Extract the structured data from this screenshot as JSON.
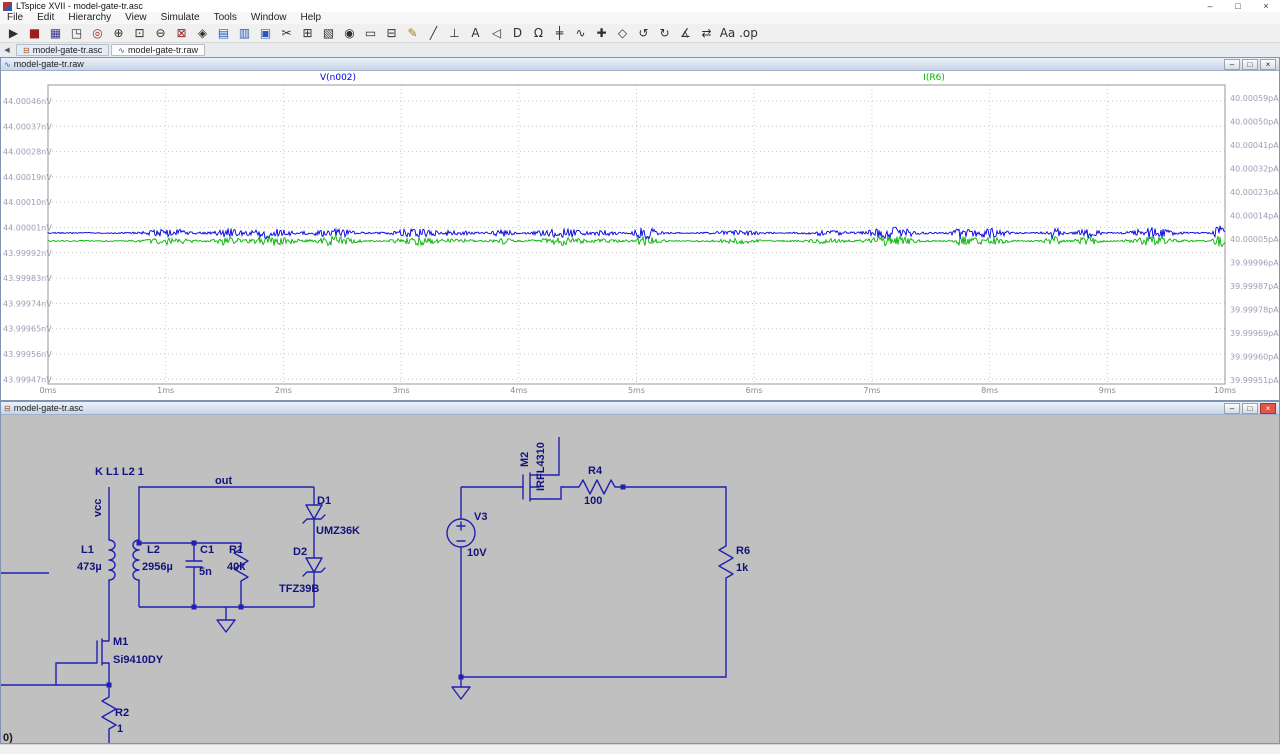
{
  "titlebar": {
    "title": "LTspice XVII - model-gate-tr.asc",
    "minimize": "–",
    "maximize": "□",
    "close": "×"
  },
  "chrome": {
    "minimize": "–",
    "maximize": "□",
    "close": "×"
  },
  "menu": {
    "items": [
      "File",
      "Edit",
      "Hierarchy",
      "View",
      "Simulate",
      "Tools",
      "Window",
      "Help"
    ]
  },
  "toolbar": {
    "icons": [
      {
        "name": "run-icon",
        "glyph": "▶",
        "color": "#303030"
      },
      {
        "name": "halt-icon",
        "glyph": "■",
        "color": "#9c1f1f"
      },
      {
        "name": "save-icon",
        "glyph": "▦",
        "color": "#39398f"
      },
      {
        "name": "autoscale-icon",
        "glyph": "◳",
        "color": "#303030"
      },
      {
        "name": "probe-icon",
        "glyph": "◎",
        "color": "#9c1f1f"
      },
      {
        "name": "zoom-in-icon",
        "glyph": "⊕",
        "color": "#303030"
      },
      {
        "name": "zoom-rect-icon",
        "glyph": "⊡",
        "color": "#303030"
      },
      {
        "name": "zoom-out-icon",
        "glyph": "⊖",
        "color": "#303030"
      },
      {
        "name": "zoom-full-icon",
        "glyph": "⊠",
        "color": "#9c1f1f"
      },
      {
        "name": "pan-icon",
        "glyph": "◈",
        "color": "#303030"
      },
      {
        "name": "tile-horizontal-icon",
        "glyph": "▤",
        "color": "#2a58b8"
      },
      {
        "name": "tile-vertical-icon",
        "glyph": "▥",
        "color": "#2a58b8"
      },
      {
        "name": "cascade-icon",
        "glyph": "▣",
        "color": "#2a58b8"
      },
      {
        "name": "cut-icon",
        "glyph": "✂",
        "color": "#303030"
      },
      {
        "name": "copy-icon",
        "glyph": "⊞",
        "color": "#303030"
      },
      {
        "name": "paste-icon",
        "glyph": "▧",
        "color": "#303030"
      },
      {
        "name": "find-icon",
        "glyph": "◉",
        "color": "#303030"
      },
      {
        "name": "print-icon",
        "glyph": "▭",
        "color": "#303030"
      },
      {
        "name": "print-preview-icon",
        "glyph": "⊟",
        "color": "#303030"
      },
      {
        "name": "pencil-icon",
        "glyph": "✎",
        "color": "#a97b00"
      },
      {
        "name": "wire-icon",
        "glyph": "╱",
        "color": "#303030"
      },
      {
        "name": "ground-icon",
        "glyph": "⊥",
        "color": "#303030"
      },
      {
        "name": "label-icon",
        "glyph": "A",
        "color": "#303030"
      },
      {
        "name": "diode-icon",
        "glyph": "◁",
        "color": "#303030"
      },
      {
        "name": "component-icon",
        "glyph": "D",
        "color": "#303030"
      },
      {
        "name": "resistor-icon",
        "glyph": "Ω",
        "color": "#303030"
      },
      {
        "name": "capacitor-icon",
        "glyph": "╪",
        "color": "#303030"
      },
      {
        "name": "inductor-icon",
        "glyph": "∿",
        "color": "#303030"
      },
      {
        "name": "move-icon",
        "glyph": "✚",
        "color": "#303030"
      },
      {
        "name": "drag-icon",
        "glyph": "◇",
        "color": "#303030"
      },
      {
        "name": "undo-icon",
        "glyph": "↺",
        "color": "#303030"
      },
      {
        "name": "redo-icon",
        "glyph": "↻",
        "color": "#303030"
      },
      {
        "name": "rotate-icon",
        "glyph": "∡",
        "color": "#303030"
      },
      {
        "name": "mirror-icon",
        "glyph": "⇄",
        "color": "#303030"
      },
      {
        "name": "text-icon",
        "glyph": "Aa",
        "color": "#303030"
      },
      {
        "name": "spice-directive-icon",
        "glyph": ".op",
        "color": "#303030"
      }
    ]
  },
  "tabs": [
    {
      "label": "model-gate-tr.asc",
      "icon": "⊟",
      "icon_name": "schematic-file-icon",
      "icon_color": "#a0522d"
    },
    {
      "label": "model-gate-tr.raw",
      "icon": "∿",
      "icon_name": "waveform-file-icon",
      "icon_color": "#2a58b8"
    }
  ],
  "wave_window": {
    "title": "model-gate-tr.raw",
    "traces": [
      {
        "label": "V(n002)",
        "color": "#0000e0"
      },
      {
        "label": "I(R6)",
        "color": "#00b400"
      }
    ],
    "left_axis": [
      "44.00046nV",
      "44.00037nV",
      "44.00028nV",
      "44.00019nV",
      "44.00010nV",
      "44.00001nV",
      "43.99992nV",
      "43.99983nV",
      "43.99974nV",
      "43.99965nV",
      "43.99956nV",
      "43.99947nV"
    ],
    "right_axis": [
      "40.00059pA",
      "40.00050pA",
      "40.00041pA",
      "40.00032pA",
      "40.00023pA",
      "40.00014pA",
      "40.00005pA",
      "39.99996pA",
      "39.99987pA",
      "39.99978pA",
      "39.99969pA",
      "39.99960pA",
      "39.99951pA"
    ],
    "x_axis": [
      "0ms",
      "1ms",
      "2ms",
      "3ms",
      "4ms",
      "5ms",
      "6ms",
      "7ms",
      "8ms",
      "9ms",
      "10ms"
    ]
  },
  "schematic": {
    "title": "model-gate-tr.asc",
    "texts": {
      "coupling": "K L1 L2 1",
      "net_vcc": "vcc",
      "net_out": "out",
      "l1_name": "L1",
      "l1_value": "473µ",
      "l2_name": "L2",
      "l2_value": "2956µ",
      "c1_name": "C1",
      "c1_value": "5n",
      "r1_name": "R1",
      "r1_value": "40k",
      "d1_name": "D1",
      "d1_value": "UMZ36K",
      "d2_name": "D2",
      "d2_value": "TFZ39B",
      "m1_name": "M1",
      "m1_value": "Si9410DY",
      "r2_name": "R2",
      "r2_value": "1",
      "v3_name": "V3",
      "v3_value": "10V",
      "m2_name": "M2",
      "m2_value": "IRFL4310",
      "r4_name": "R4",
      "r4_value": "100",
      "r6_name": "R6",
      "r6_value": "1k",
      "clipped_directive": "0)"
    },
    "wire_color": "#2121b0",
    "background": "#c0c0c0"
  },
  "chart_data": {
    "type": "line",
    "title": "",
    "x_ticks": [
      "0ms",
      "1ms",
      "2ms",
      "3ms",
      "4ms",
      "5ms",
      "6ms",
      "7ms",
      "8ms",
      "9ms",
      "10ms"
    ],
    "x_range_ms": [
      0,
      10
    ],
    "left_ticks_nV": [
      44.00046,
      44.00037,
      44.00028,
      44.00019,
      44.0001,
      44.00001,
      43.99992,
      43.99983,
      43.99974,
      43.99965,
      43.99956,
      43.99947
    ],
    "right_ticks_pA": [
      40.00059,
      40.0005,
      40.00041,
      40.00032,
      40.00023,
      40.00014,
      40.00005,
      39.99996,
      39.99987,
      39.99978,
      39.99969,
      39.9996,
      39.99951
    ],
    "grid": true,
    "legend_position": "top-inside",
    "series": [
      {
        "name": "V(n002)",
        "axis": "left",
        "unit": "nV",
        "color": "#0000e0",
        "mean": 44.00001,
        "description": "essentially flat trace at ~44.00001 nV with intermittent random noise bursts, peak deviation about ±0.00004 nV"
      },
      {
        "name": "I(R6)",
        "axis": "right",
        "unit": "pA",
        "color": "#00b400",
        "mean": 40.0,
        "description": "essentially flat trace at ~40.00000 pA with intermittent random noise bursts, peak deviation about ±0.00003 pA"
      }
    ]
  }
}
